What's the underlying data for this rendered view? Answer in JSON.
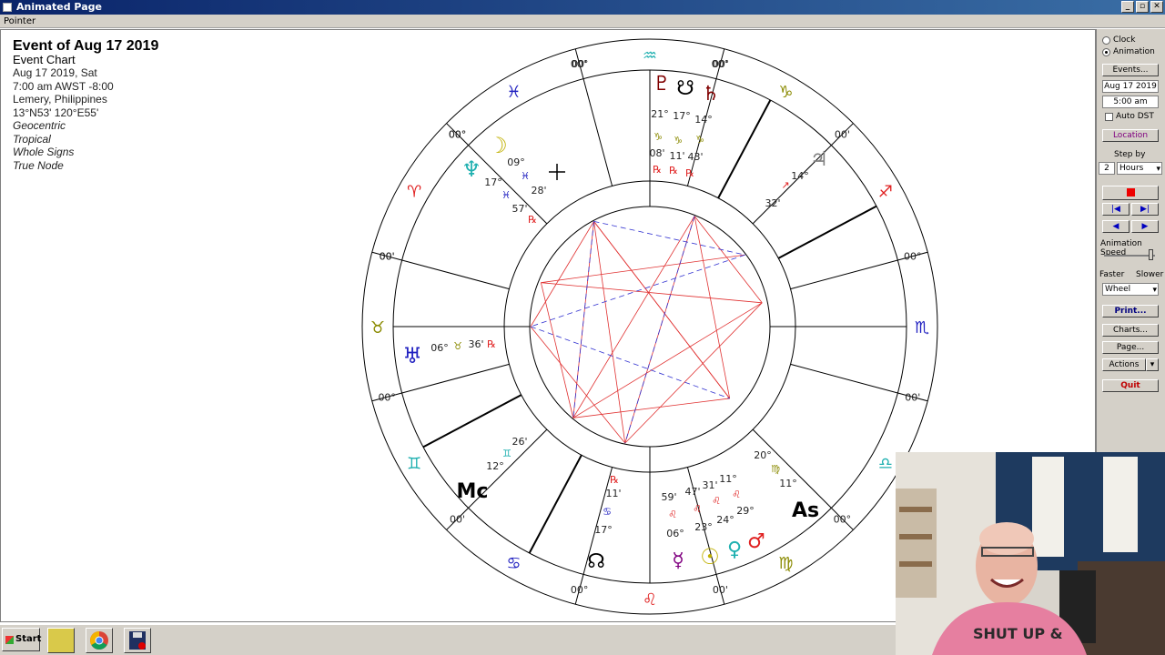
{
  "window": {
    "title": "Animated Page",
    "controls": [
      "_",
      "▫",
      "✕"
    ]
  },
  "menu": {
    "pointer": "Pointer"
  },
  "info": {
    "title": "Event of Aug 17 2019",
    "subtitle": "Event Chart",
    "date": "Aug 17 2019, Sat",
    "time": "7:00 am  AWST -8:00",
    "place": "Lemery, Philippines",
    "coords": "13°N53' 120°E55'",
    "opts": [
      "Geocentric",
      "Tropical",
      "Whole Signs",
      "True Node"
    ]
  },
  "panel": {
    "clock": "Clock",
    "animation": "Animation",
    "events": "Events...",
    "date": "Aug 17 2019",
    "time": "5:00 am",
    "autodst": "Auto DST",
    "location": "Location",
    "stepby": "Step by",
    "step_value": "2",
    "step_unit": "Hours",
    "anim_speed": "Animation Speed",
    "faster": "Faster",
    "slower": "Slower",
    "wheel": "Wheel",
    "print": "Print...",
    "charts": "Charts...",
    "page": "Page...",
    "actions": "Actions",
    "quit": "Quit"
  },
  "taskbar": {
    "start": "Start"
  },
  "chart": {
    "cusp_labels": [
      {
        "a": -75,
        "t": "00'"
      },
      {
        "a": -105,
        "t": "00°"
      },
      {
        "a": -45,
        "t": "00'"
      },
      {
        "a": -15,
        "t": "00°"
      },
      {
        "a": 15,
        "t": "00'"
      },
      {
        "a": 45,
        "t": "00°"
      },
      {
        "a": 75,
        "t": "00'"
      },
      {
        "a": 105,
        "t": "00°"
      },
      {
        "a": 135,
        "t": "00'"
      },
      {
        "a": 165,
        "t": "00°"
      },
      {
        "a": -165,
        "t": "00'"
      },
      {
        "a": -135,
        "t": "00°"
      },
      {
        "a": 195,
        "t": "00'"
      },
      {
        "a": 225,
        "t": "00°"
      },
      {
        "a": 255,
        "t": "00'"
      },
      {
        "a": 285,
        "t": "00°"
      }
    ],
    "signs": [
      {
        "a": -90,
        "g": "♒",
        "c": "#1fb0b0"
      },
      {
        "a": -60,
        "g": "♑",
        "c": "#8a8a00"
      },
      {
        "a": -30,
        "g": "♐",
        "c": "#e02020"
      },
      {
        "a": 0,
        "g": "♏",
        "c": "#2020c0"
      },
      {
        "a": 30,
        "g": "♎",
        "c": "#1fb0b0"
      },
      {
        "a": 60,
        "g": "♍",
        "c": "#8a8a00"
      },
      {
        "a": 90,
        "g": "♌",
        "c": "#e02020"
      },
      {
        "a": 120,
        "g": "♋",
        "c": "#2020c0"
      },
      {
        "a": 150,
        "g": "♊",
        "c": "#1fb0b0"
      },
      {
        "a": 180,
        "g": "♉",
        "c": "#8a8a00"
      },
      {
        "a": 210,
        "g": "♈",
        "c": "#e02020"
      },
      {
        "a": 240,
        "g": "♓",
        "c": "#2020c0"
      }
    ],
    "planet_labels": {
      "pluto": "♇",
      "node_s": "☋",
      "saturn": "♄",
      "pl_deg": "21°",
      "no_deg": "17°",
      "sa_deg": "14°",
      "pl_min": "08'",
      "no_min": "11'",
      "sa_min": "43'",
      "jupiter": "♃",
      "ju_deg": "14°",
      "ju_min": "32'",
      "moon": "☽",
      "mo_deg": "09°",
      "mo_min": "28'",
      "neptune": "♆",
      "ne_deg": "17°",
      "ne_min": "57'",
      "uranus": "♅",
      "ur_deg": "06°",
      "ur_min": "36'",
      "mc": "Mc",
      "mc_deg": "12°",
      "mc_min": "26'",
      "node_n": "☊",
      "nn_deg": "11'",
      "nn_min": "17°",
      "mercury": "☿",
      "sun": "☉",
      "venus": "♀",
      "mars": "♂",
      "as": "As",
      "as_deg": "20°",
      "as_min": "11°",
      "me_deg": "59'",
      "su_deg": "47'",
      "ve_deg": "31'",
      "ma_deg": "11°",
      "me2": "06°",
      "su2": "23°",
      "ve2": "24°",
      "ma2": "29°",
      "retro": "℞"
    }
  }
}
